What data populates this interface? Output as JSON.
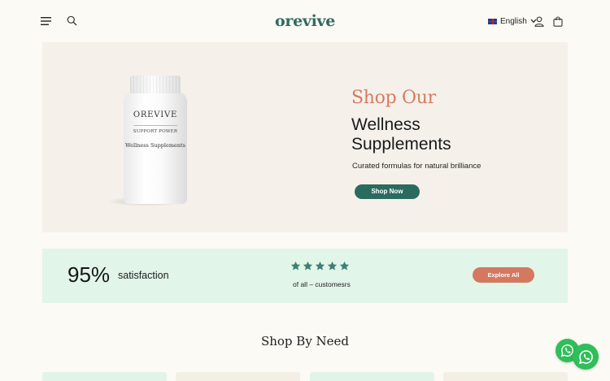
{
  "header": {
    "logo": "orevive",
    "language": "English"
  },
  "hero": {
    "eyebrow": "Shop Our",
    "title": "Wellness Supplements",
    "subtitle": "Curated formulas for natural brilliance",
    "cta_label": "Shop Now",
    "bottle": {
      "brand": "OREVIVE",
      "line1": "SUPPORT POWER",
      "line2": "Wellness Supplements"
    }
  },
  "satisfaction": {
    "percent": "95%",
    "label": "satisfaction",
    "rating": 5,
    "rating_max": 5,
    "caption": "of all – customesrs",
    "cta_label": "Explore All"
  },
  "shop_by_need": {
    "title": "Shop By Need"
  },
  "colors": {
    "brand_green": "#2e6b5e",
    "accent_coral": "#d47c63",
    "band_mint": "#e1f5e9",
    "whatsapp": "#2fbe5a"
  },
  "icons": [
    "menu-icon",
    "search-icon",
    "flag-uk-icon",
    "chevron-down-icon",
    "user-icon",
    "bag-icon",
    "star-icon",
    "whatsapp-icon"
  ]
}
